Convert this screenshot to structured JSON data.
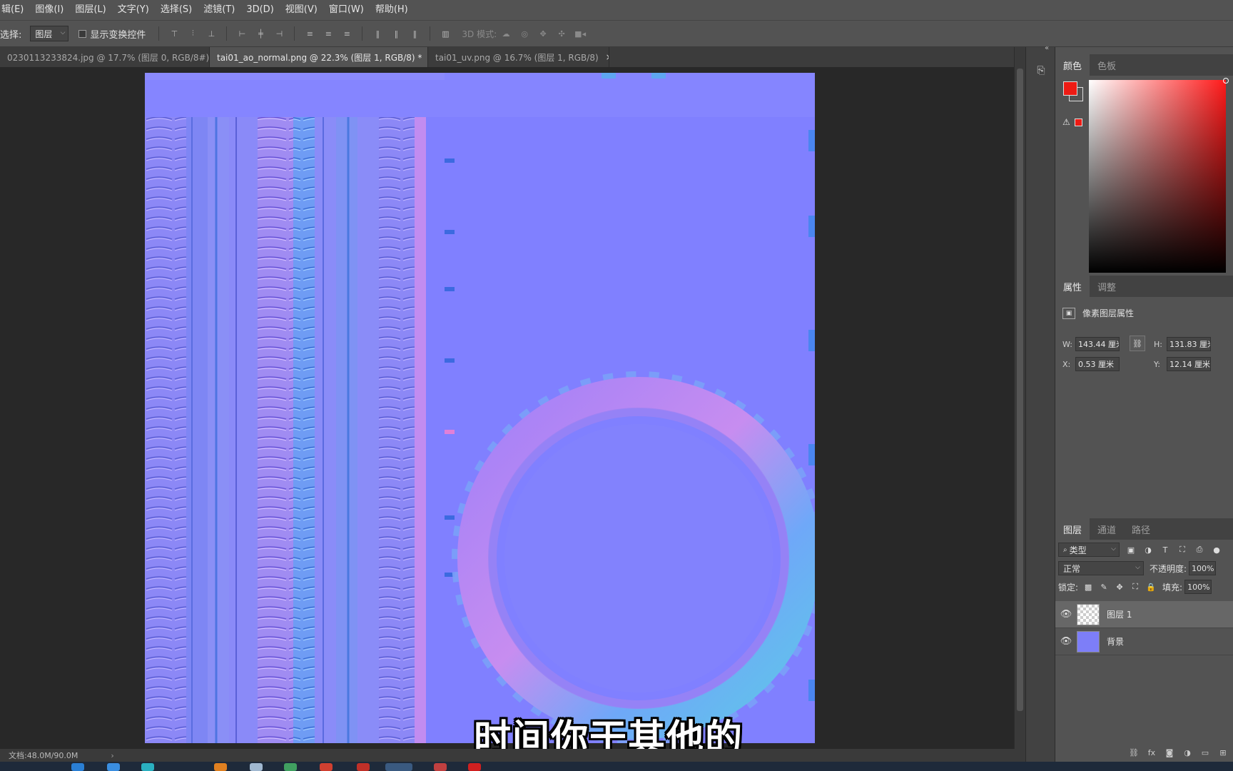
{
  "menubar": {
    "items": [
      "辑(E)",
      "图像(I)",
      "图层(L)",
      "文字(Y)",
      "选择(S)",
      "滤镜(T)",
      "3D(D)",
      "视图(V)",
      "窗口(W)",
      "帮助(H)"
    ]
  },
  "options_bar": {
    "select_label": "选择:",
    "select_value": "图层",
    "show_transform_label": "显示变换控件",
    "mode_3d_label": "3D 模式:"
  },
  "doc_tabs": [
    {
      "title": "0230113233824.jpg @ 17.7% (图层 0, RGB/8#) *",
      "close": "×"
    },
    {
      "title": "tai01_ao_normal.png @ 22.3% (图层 1, RGB/8) *",
      "close": "×"
    },
    {
      "title": "tai01_uv.png @ 16.7% (图层 1, RGB/8)",
      "close": "×"
    }
  ],
  "canvas": {
    "subtitle": "时间你干其他的",
    "base_color": "#8080ff"
  },
  "status_bar": {
    "doc_size": "文档:48.0M/90.0M",
    "arrow": "›"
  },
  "color_panel": {
    "tabs": [
      "颜色",
      "色板"
    ],
    "foreground": "#ee1b14",
    "warning_icon": "⚠"
  },
  "properties_panel": {
    "tabs": [
      "属性",
      "调整"
    ],
    "title": "像素图层属性",
    "w_label": "W:",
    "w_value": "143.44 厘米",
    "h_label": "H:",
    "h_value": "131.83 厘米",
    "x_label": "X:",
    "x_value": "0.53 厘米",
    "y_label": "Y:",
    "y_value": "12.14 厘米"
  },
  "layers_panel": {
    "tabs": [
      "图层",
      "通道",
      "路径"
    ],
    "filter_value": "类型",
    "blend_mode": "正常",
    "opacity_label": "不透明度:",
    "opacity_value": "100%",
    "lock_label": "锁定:",
    "fill_label": "填充:",
    "fill_value": "100%",
    "layers": [
      {
        "name": "图层 1",
        "selected": true
      },
      {
        "name": "背景",
        "selected": false
      }
    ]
  }
}
